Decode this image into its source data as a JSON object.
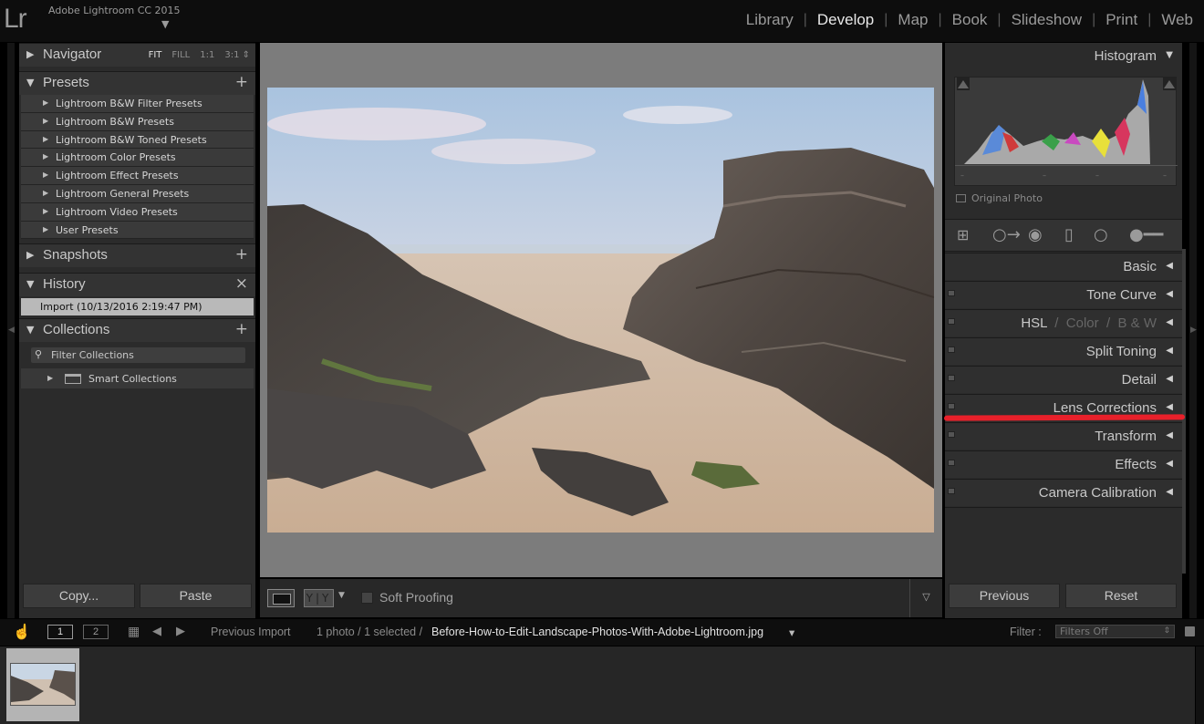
{
  "app": {
    "logo": "Lr",
    "title": "Adobe Lightroom CC 2015",
    "modules": [
      "Library",
      "Develop",
      "Map",
      "Book",
      "Slideshow",
      "Print",
      "Web"
    ],
    "active_module": "Develop"
  },
  "left_panel": {
    "navigator": {
      "title": "Navigator",
      "zoom_options": [
        "FIT",
        "FILL",
        "1:1",
        "3:1"
      ],
      "active_zoom": "FIT"
    },
    "presets": {
      "title": "Presets",
      "add_symbol": "+",
      "items": [
        "Lightroom B&W Filter Presets",
        "Lightroom B&W Presets",
        "Lightroom B&W Toned Presets",
        "Lightroom Color Presets",
        "Lightroom Effect Presets",
        "Lightroom General Presets",
        "Lightroom Video Presets",
        "User Presets"
      ]
    },
    "snapshots": {
      "title": "Snapshots",
      "add_symbol": "+"
    },
    "history": {
      "title": "History",
      "clear_symbol": "×",
      "items": [
        "Import (10/13/2016 2:19:47 PM)"
      ]
    },
    "collections": {
      "title": "Collections",
      "add_symbol": "+",
      "filter_placeholder": "Filter Collections",
      "items": [
        "Smart Collections"
      ]
    },
    "copy_button": "Copy...",
    "paste_button": "Paste"
  },
  "toolbar": {
    "yy_label": "Y|Y",
    "soft_proofing": "Soft Proofing"
  },
  "right_panel": {
    "histogram": {
      "title": "Histogram",
      "original_photo": "Original Photo"
    },
    "panels": [
      {
        "label": "Basic",
        "has_switch": false
      },
      {
        "label": "Tone Curve",
        "has_switch": true
      },
      {
        "label": "HSL / Color / B & W",
        "has_switch": true,
        "parts": [
          "HSL",
          "Color",
          "B & W"
        ]
      },
      {
        "label": "Split Toning",
        "has_switch": true
      },
      {
        "label": "Detail",
        "has_switch": true
      },
      {
        "label": "Lens Corrections",
        "has_switch": true,
        "highlighted": true
      },
      {
        "label": "Transform",
        "has_switch": true
      },
      {
        "label": "Effects",
        "has_switch": true
      },
      {
        "label": "Camera Calibration",
        "has_switch": true
      }
    ],
    "previous_button": "Previous",
    "reset_button": "Reset"
  },
  "filmstrip": {
    "screen_buttons": [
      "1",
      "2"
    ],
    "source": "Previous Import",
    "status_prefix": "1 photo / 1 selected /",
    "filename": "Before-How-to-Edit-Landscape-Photos-With-Adobe-Lightroom.jpg",
    "filter_label": "Filter :",
    "filter_value": "Filters Off"
  },
  "colors": {
    "highlight_line": "#e8202a",
    "panel_bg": "#2b2b2b",
    "canvas_bg": "#7c7c7c"
  }
}
